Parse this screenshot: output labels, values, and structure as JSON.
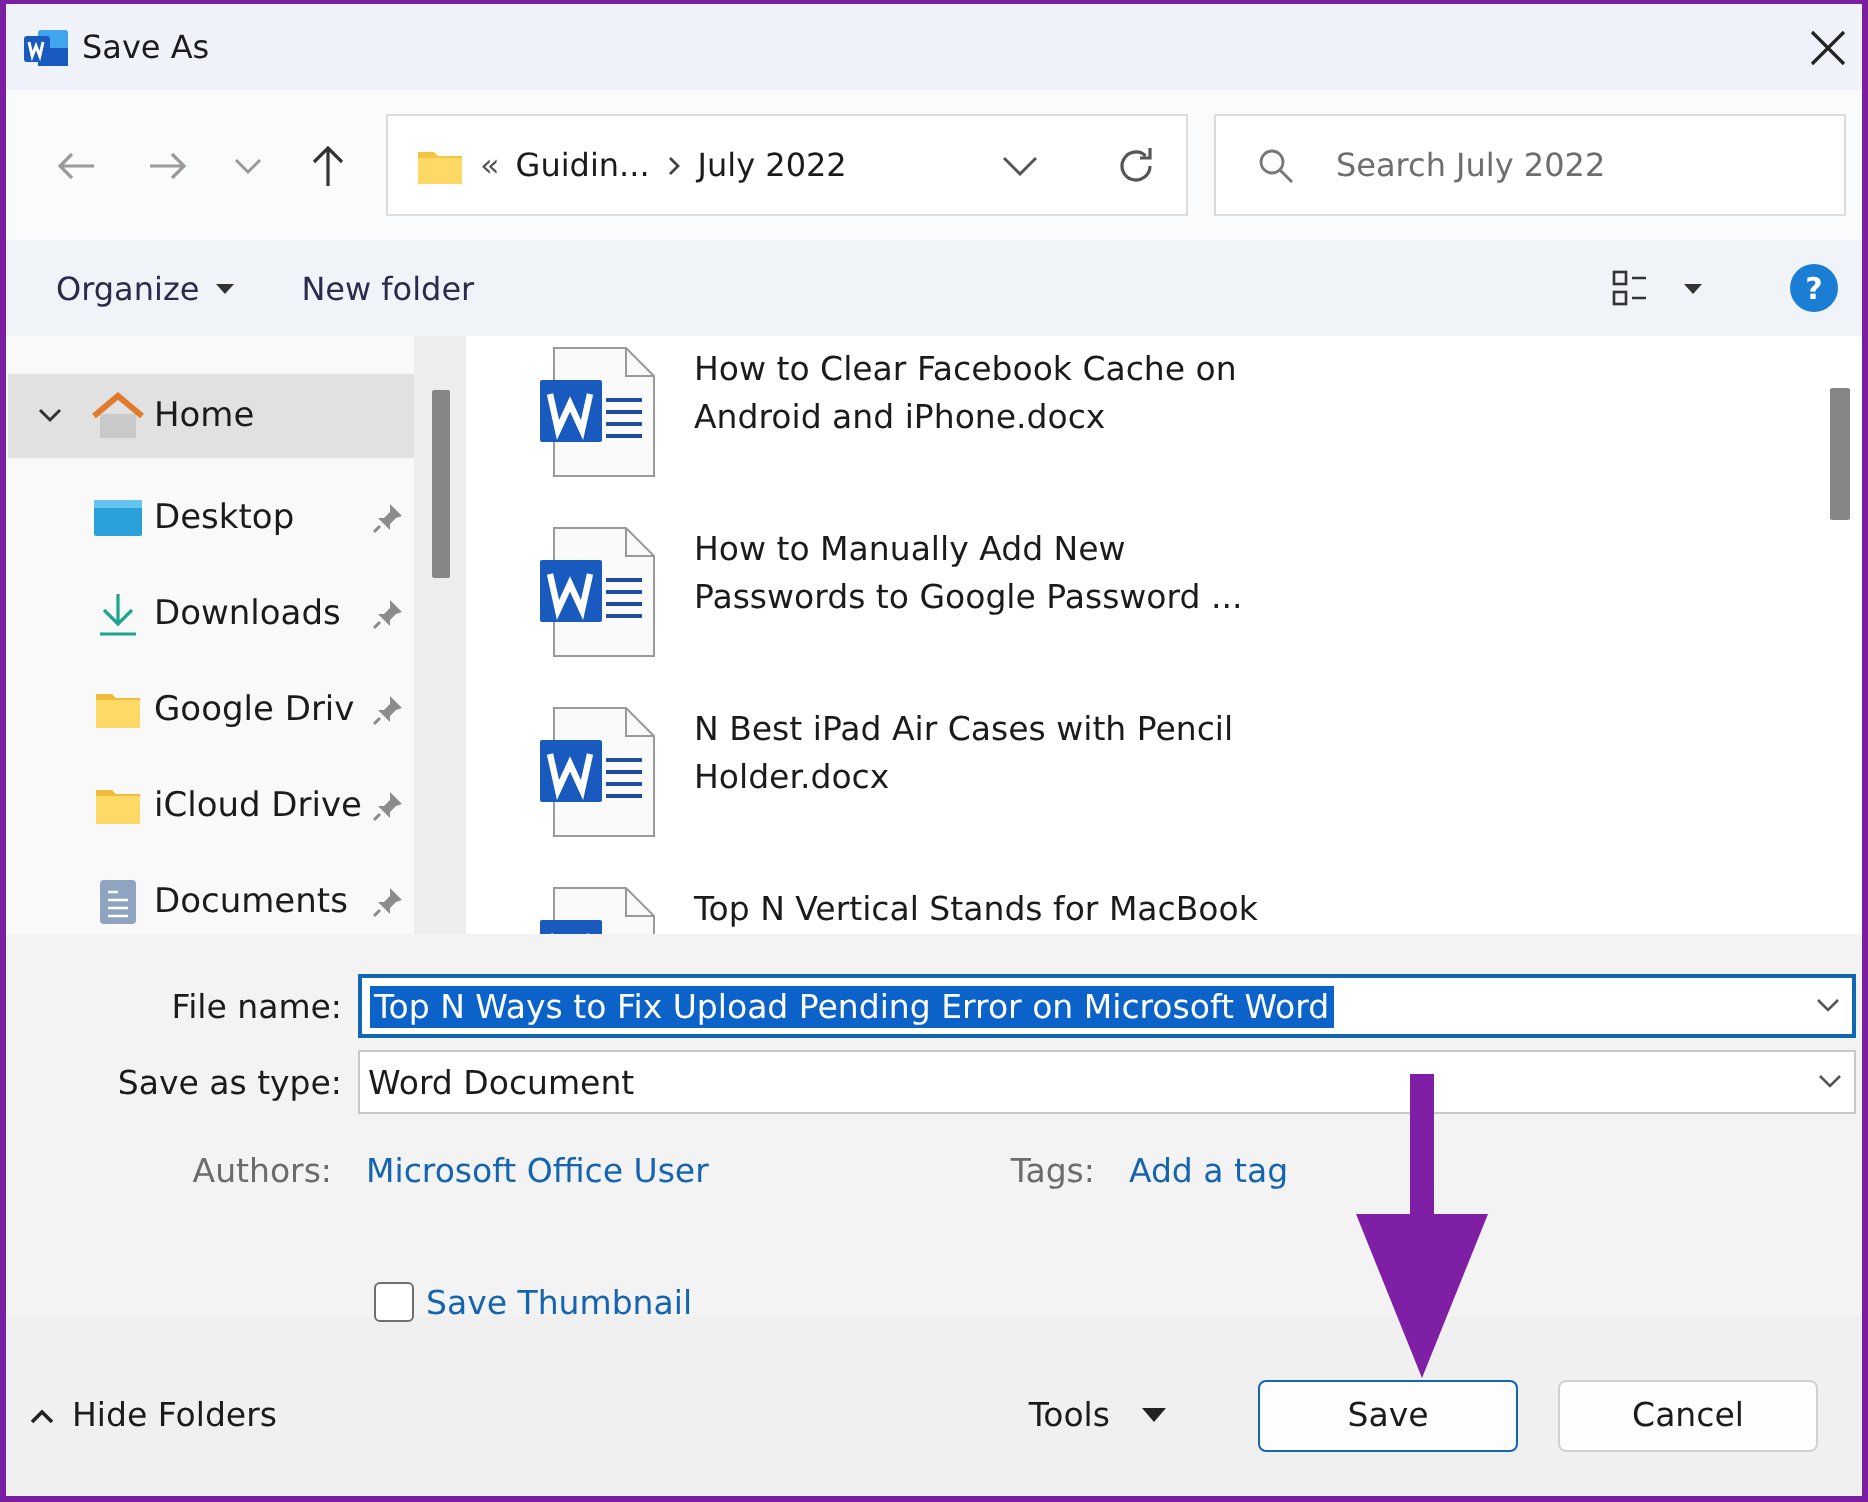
{
  "window": {
    "title": "Save As"
  },
  "address": {
    "overflow": "«",
    "folders": [
      "Guidin...",
      "July 2022"
    ]
  },
  "search": {
    "placeholder": "Search July 2022"
  },
  "toolbar": {
    "organize": "Organize",
    "new_folder": "New folder",
    "help": "?"
  },
  "nav_pane": {
    "items": [
      {
        "label": "Home",
        "kind": "home",
        "expanded": true,
        "selected": true
      },
      {
        "label": "Desktop",
        "kind": "desktop",
        "pinned": true,
        "selected": false
      },
      {
        "label": "Downloads",
        "kind": "downloads",
        "pinned": true,
        "selected": false
      },
      {
        "label": "Google Driv",
        "kind": "folder",
        "pinned": true,
        "selected": false
      },
      {
        "label": "iCloud Drive",
        "kind": "folder",
        "pinned": true,
        "selected": false
      },
      {
        "label": "Documents",
        "kind": "documents",
        "pinned": true,
        "selected": false
      }
    ]
  },
  "files": [
    {
      "name_lines": [
        "How to Clear Facebook Cache on",
        "Android and iPhone.docx"
      ]
    },
    {
      "name_lines": [
        "How to Manually Add New",
        "Passwords to Google Password ..."
      ]
    },
    {
      "name_lines": [
        "N Best iPad Air Cases with Pencil",
        "Holder.docx"
      ]
    },
    {
      "name_lines": [
        "Top N Vertical Stands for MacBook"
      ]
    }
  ],
  "form": {
    "file_name": {
      "label": "File name:",
      "value": "Top N Ways to Fix Upload Pending Error on Microsoft Word",
      "text_selected": true
    },
    "save_as_type": {
      "label": "Save as type:",
      "value": "Word Document"
    },
    "authors": {
      "label": "Authors:",
      "value": "Microsoft Office User"
    },
    "tags": {
      "label": "Tags:",
      "value": "Add a tag"
    },
    "save_thumbnail": {
      "label": "Save Thumbnail",
      "checked": false
    }
  },
  "footer": {
    "hide_folders": "Hide Folders",
    "tools": "Tools",
    "buttons": [
      {
        "label": "Save",
        "kind": "default"
      },
      {
        "label": "Cancel",
        "kind": "normal"
      }
    ]
  }
}
